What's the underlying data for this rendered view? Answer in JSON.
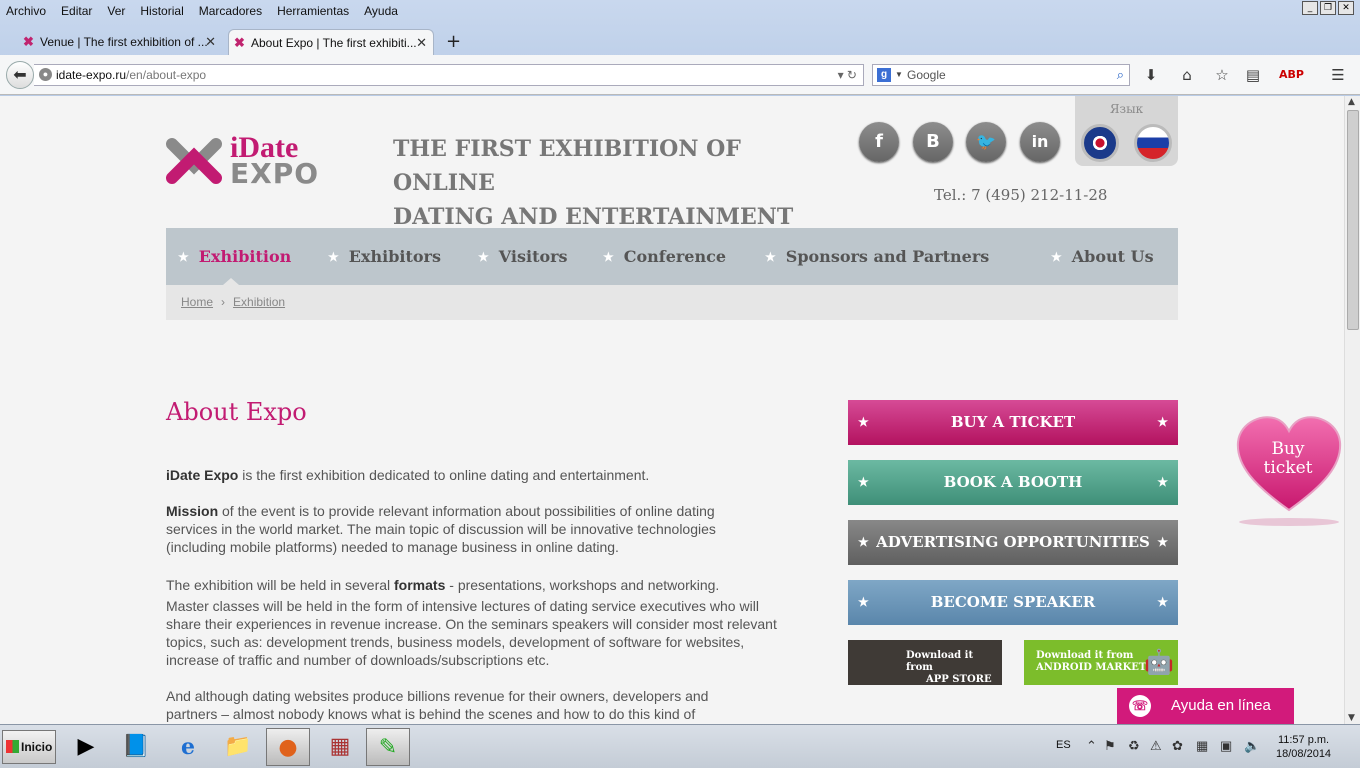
{
  "browser": {
    "menu": [
      "Archivo",
      "Editar",
      "Ver",
      "Historial",
      "Marcadores",
      "Herramientas",
      "Ayuda"
    ],
    "tabs": [
      {
        "title": "Venue | The first exhibition of ..."
      },
      {
        "title": "About Expo | The first exhibiti..."
      }
    ],
    "url_host": "idate-expo.ru",
    "url_path": "/en/about-expo",
    "search_placeholder": "Google",
    "search_engine_letter": "g"
  },
  "header": {
    "logo_line1": "iDate",
    "logo_line2": "EXPO",
    "tagline_line1": "THE FIRST EXHIBITION OF ONLINE",
    "tagline_line2": "DATING AND ENTERTAINMENT",
    "social": [
      {
        "label": "f",
        "icon": "facebook-icon"
      },
      {
        "label": "B",
        "icon": "vkontakte-icon"
      },
      {
        "label": "🐦",
        "icon": "twitter-icon"
      },
      {
        "label": "in",
        "icon": "linkedin-icon"
      }
    ],
    "language_label": "Язык",
    "phone": "Tel.: 7 (495) 212-11-28"
  },
  "nav": {
    "items": [
      "Exhibition",
      "Exhibitors",
      "Visitors",
      "Conference",
      "Sponsors and Partners",
      "About Us"
    ],
    "active": "Exhibition"
  },
  "breadcrumb": {
    "home": "Home",
    "current": "Exhibition",
    "separator": "›"
  },
  "content": {
    "title": "About Expo",
    "p1_bold": "iDate Expo",
    "p1_rest": " is the first exhibition dedicated to online dating and entertainment.",
    "p2_bold": "Mission",
    "p2_rest": " of the event is to provide relevant information about possibilities of online dating services in the world market. The main topic of discussion will be innovative technologies (including mobile platforms) needed to manage business in online dating.",
    "p3_start": "The exhibition will be held in several ",
    "p3_bold": "formats",
    "p3_rest": " - presentations, workshops and networking.",
    "p4": "Master classes will be held in the form of intensive lectures of dating service executives who will share their experiences in revenue increase. On the seminars speakers will consider most relevant topics, such as: development trends, business models, development of software for websites, increase of traffic and number of downloads/subscriptions etc.",
    "p5": "And although dating websites produce billions revenue for their owners, developers and partners – almost nobody knows what is behind the scenes and how to do this kind of"
  },
  "sidebar": {
    "buy_ticket": "BUY A TICKET",
    "book_booth": "BOOK A BOOTH",
    "advertising": "ADVERTISING OPPORTUNITIES",
    "speaker": "BECOME SPEAKER",
    "appstore_l1": "Download it from",
    "appstore_l2": "APP STORE",
    "android_l1": "Download it from",
    "android_l2": "ANDROID MARKET",
    "star": "★"
  },
  "floating": {
    "heart_line1": "Buy",
    "heart_line2": "ticket",
    "help_chat": "Ayuda en línea"
  },
  "taskbar": {
    "start": "Inicio",
    "lang": "ES",
    "time": "11:57 p.m.",
    "date": "18/08/2014"
  },
  "colors": {
    "brand": "#c21b72",
    "booth": "#4f9f88",
    "advertising": "#6f6f6f",
    "speaker": "#6a94b8",
    "android": "#7cbd2b"
  }
}
